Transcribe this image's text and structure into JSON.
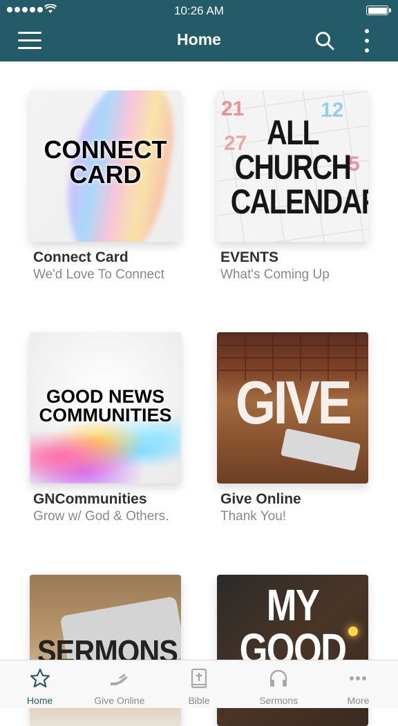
{
  "status_bar": {
    "time": "10:26 AM"
  },
  "header": {
    "title": "Home"
  },
  "colors": {
    "primary": "#245b68",
    "inactive": "#8a8a8a"
  },
  "cards": [
    {
      "image_text": "CONNECT\nCARD",
      "title": "Connect Card",
      "subtitle": "We'd Love To Connect"
    },
    {
      "image_text": "ALL\nCHURCH\nCALENDAR",
      "title": "EVENTS",
      "subtitle": "What's Coming Up"
    },
    {
      "image_text": "GOOD NEWS\nCOMMUNITIES",
      "title": "GNCommunities",
      "subtitle": "Grow w/ God & Others."
    },
    {
      "image_text": "GIVE",
      "title": "Give Online",
      "subtitle": "Thank You!"
    },
    {
      "image_text": "SERMONS"
    },
    {
      "image_text": "MY\nGOOD"
    }
  ],
  "calendar_numbers": [
    "21",
    "27",
    "12",
    "5"
  ],
  "tabs": [
    {
      "label": "Home",
      "icon": "star-icon",
      "active": true
    },
    {
      "label": "Give Online",
      "icon": "give-hand-icon",
      "active": false
    },
    {
      "label": "Bible",
      "icon": "bible-icon",
      "active": false
    },
    {
      "label": "Sermons",
      "icon": "headphones-icon",
      "active": false
    },
    {
      "label": "More",
      "icon": "more-dots-icon",
      "active": false
    }
  ]
}
